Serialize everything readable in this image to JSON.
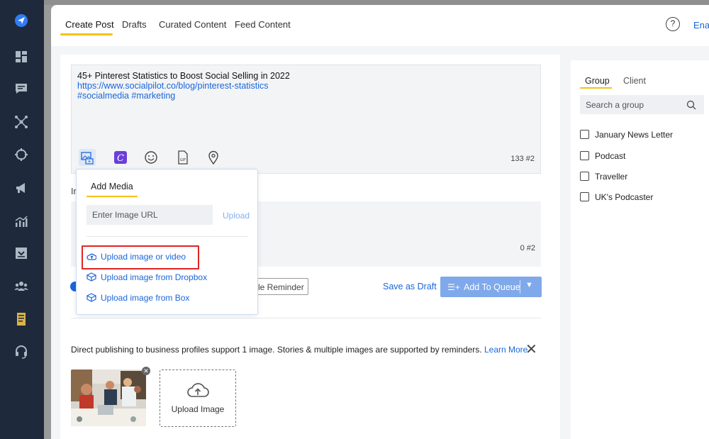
{
  "tabs": {
    "create_post": "Create Post",
    "drafts": "Drafts",
    "curated": "Curated Content",
    "feed": "Feed Content",
    "help": "?",
    "enable": "Enal"
  },
  "composer": {
    "line1": "45+ Pinterest Statistics to Boost Social Selling in 2022",
    "line2": "https://www.socialpilot.co/blog/pinterest-statistics",
    "line3": "#socialmedia #marketing",
    "char_count": "133",
    "hashtag_count": "#2",
    "tool_icons": [
      "media-icon",
      "canva-icon",
      "emoji-icon",
      "gif-icon",
      "location-icon"
    ]
  },
  "composer2": {
    "char_count": "0",
    "hashtag_count": "#2",
    "label_fragment": "Ir"
  },
  "media_popup": {
    "title": "Add Media",
    "url_placeholder": "Enter Image URL",
    "upload_label": "Upload",
    "options": [
      "Upload image or video",
      "Upload image from Dropbox",
      "Upload image from Box"
    ]
  },
  "actions": {
    "reminder_fragment": "le Reminder",
    "save_draft": "Save as Draft",
    "add_to_queue": "Add To Queue"
  },
  "notice": {
    "text": "Direct publishing to business profiles support 1 image. Stories & multiple images are supported by reminders.",
    "learn_more": "Learn More"
  },
  "upload": {
    "label": "Upload Image"
  },
  "side_panel": {
    "tab_group": "Group",
    "tab_client": "Client",
    "search_placeholder": "Search a group",
    "groups": [
      "January News Letter",
      "Podcast",
      "Traveller",
      "UK's Podcaster"
    ]
  },
  "colors": {
    "sidebar": "#1e2a3b",
    "accent_yellow": "#f3c21b",
    "link_blue": "#1a66d9",
    "queue_button": "#7fa9ea",
    "highlight_red": "#e02424"
  }
}
